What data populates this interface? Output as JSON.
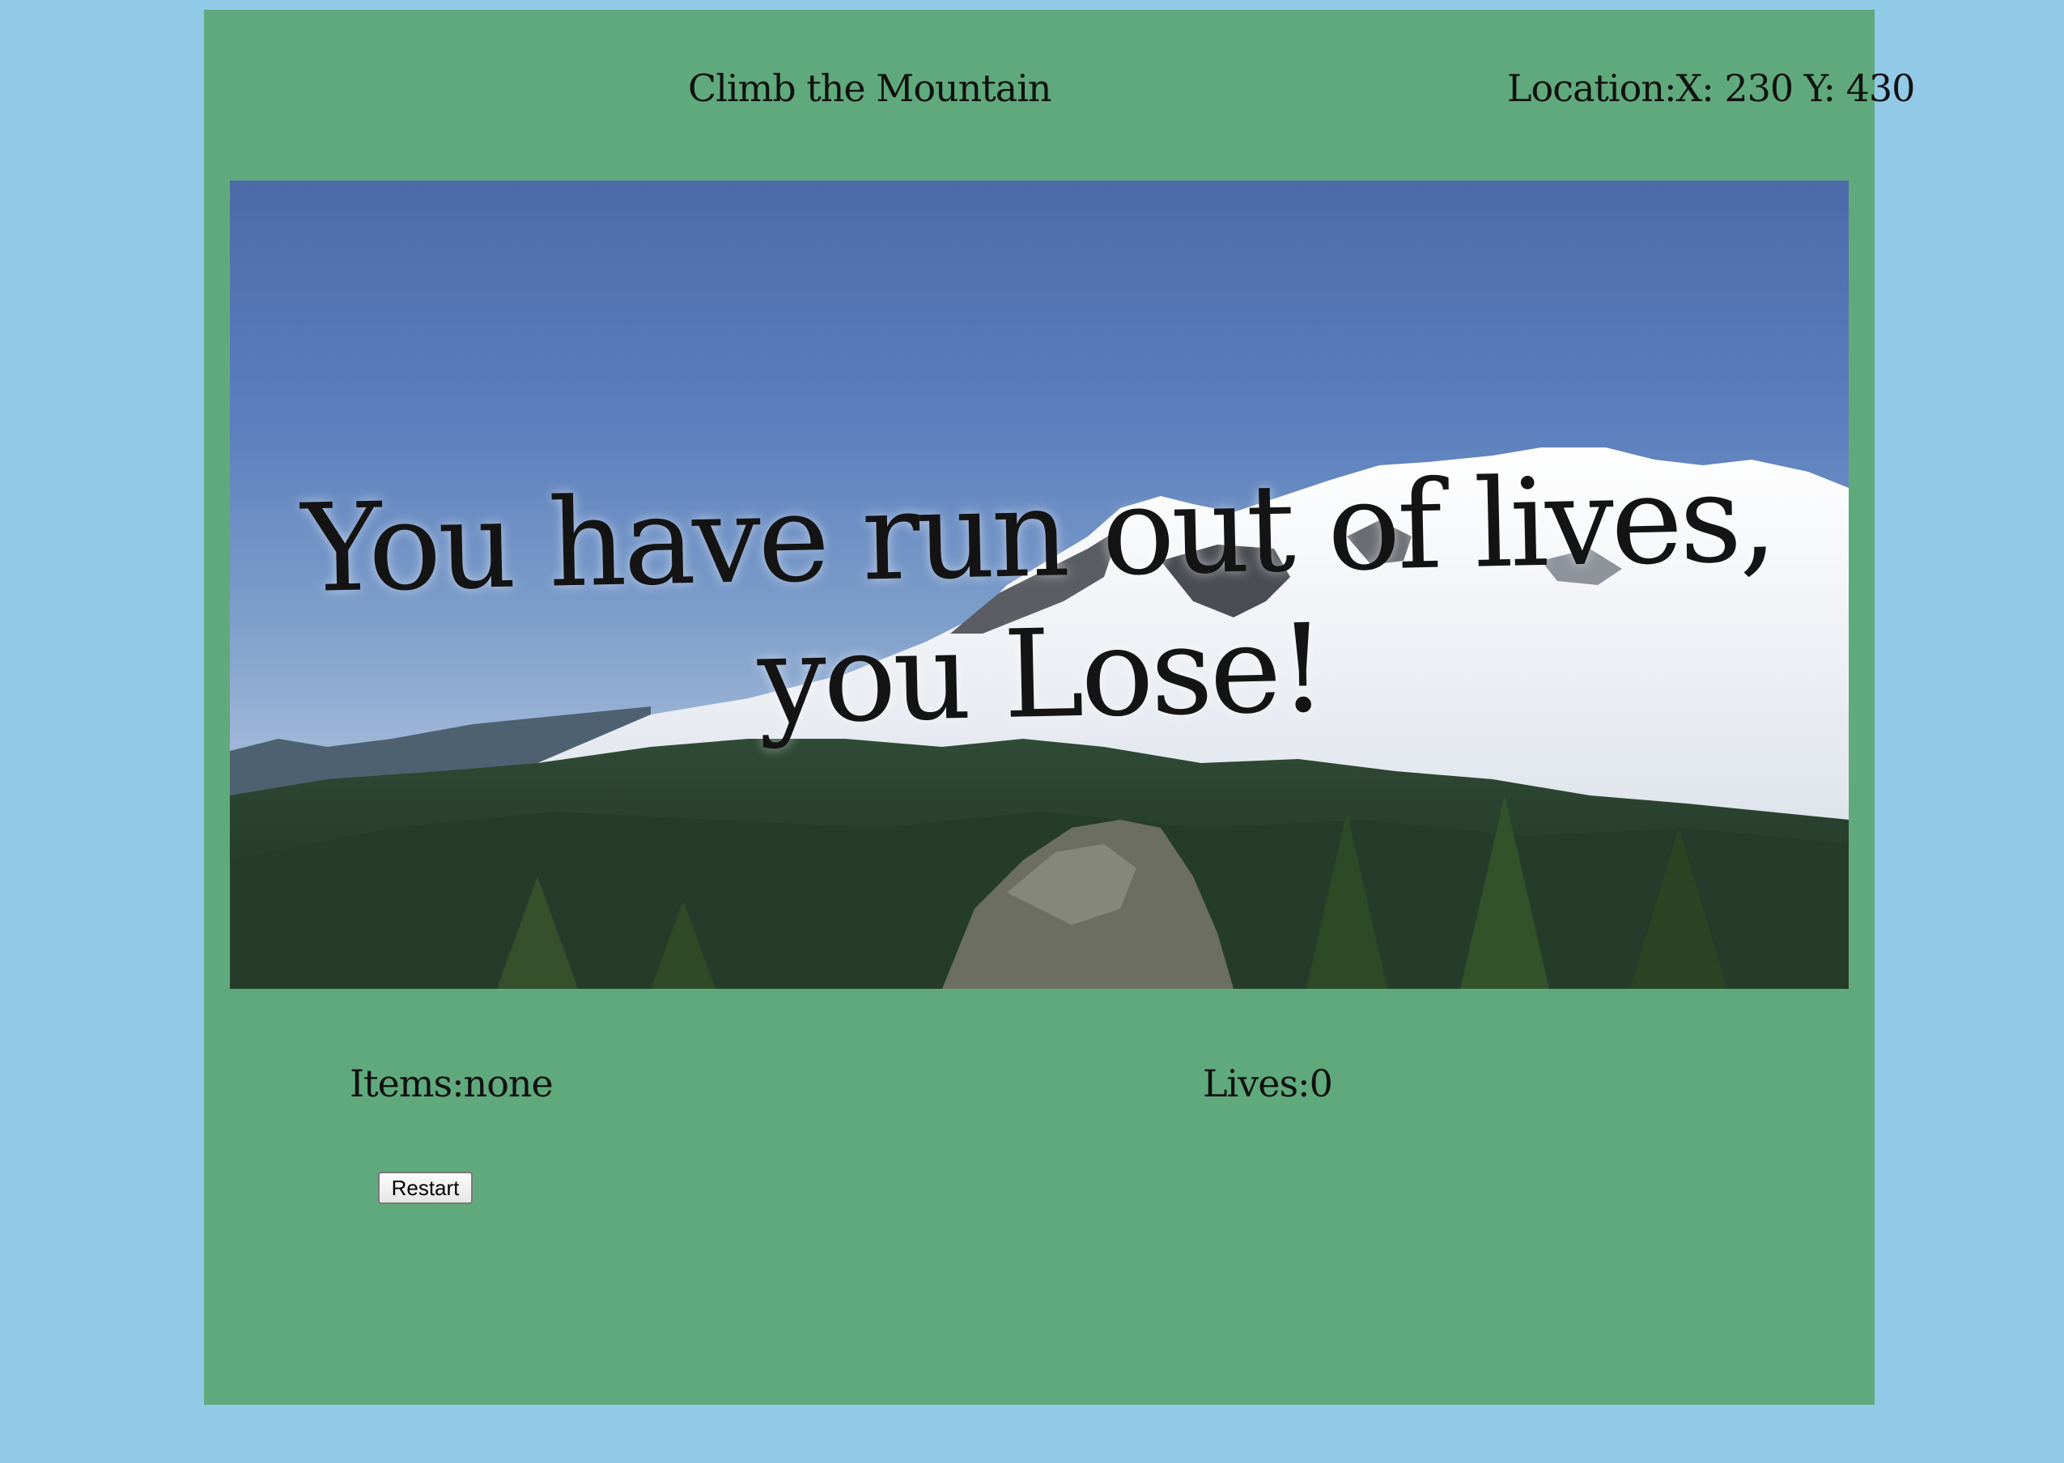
{
  "game": {
    "title": "Climb the Mountain",
    "location_label": "Location:",
    "location_x_label": "X:",
    "location_x_value": "230",
    "location_y_label": "Y:",
    "location_y_value": "430",
    "message": "You have run out of lives, you Lose!",
    "items_label": "Items:",
    "items_value": "none",
    "lives_label": "Lives:",
    "lives_value": "0",
    "restart_label": "Restart"
  },
  "colors": {
    "page_background": "#92c9e6",
    "panel_background": "#60a97c",
    "text": "#111111"
  }
}
